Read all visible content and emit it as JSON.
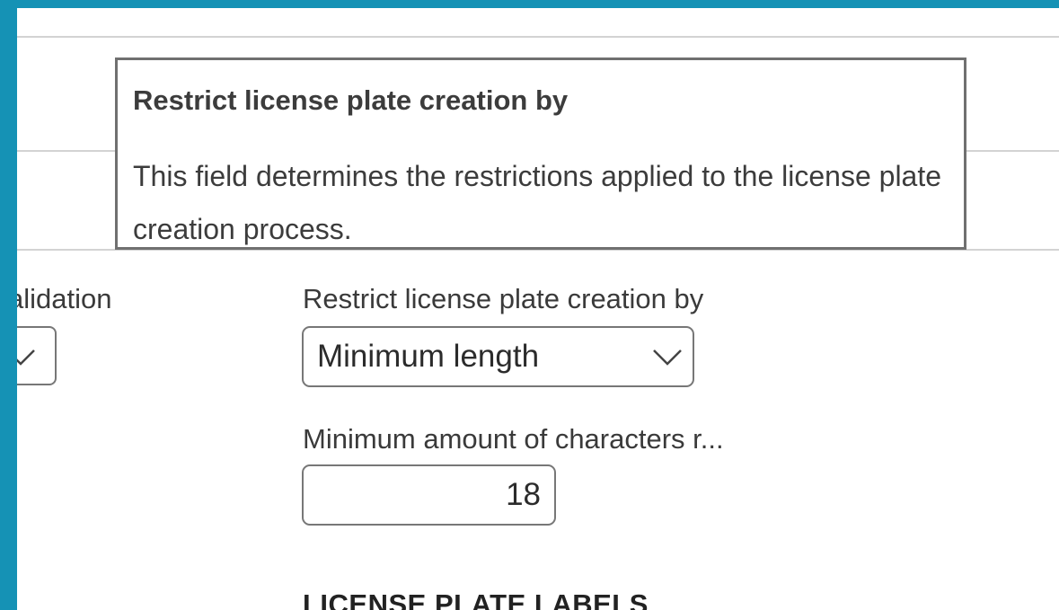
{
  "tooltip": {
    "title": "Restrict license plate creation by",
    "body": "This field determines the restrictions applied to the license plate creation process."
  },
  "form": {
    "validation_label": "alidation",
    "restrict_label": "Restrict license plate creation by",
    "restrict_value": "Minimum length",
    "min_chars_label": "Minimum amount of characters r...",
    "min_chars_value": "18",
    "section_heading": "LICENSE PLATE LABELS"
  },
  "icons": {
    "dropdown": "chevron-down-icon"
  },
  "colors": {
    "frame_border": "#1592b5",
    "tooltip_border": "#707070",
    "text": "#3a3a3a"
  }
}
